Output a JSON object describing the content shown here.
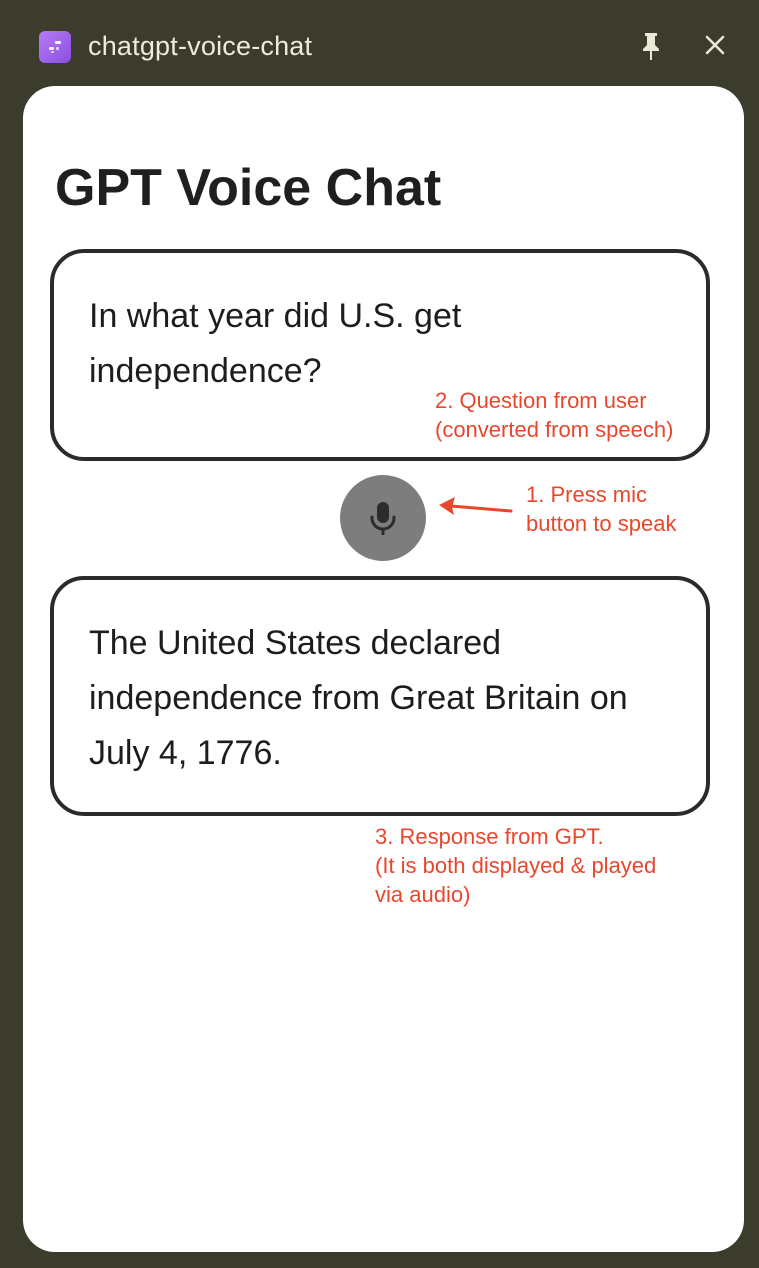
{
  "window": {
    "title": "chatgpt-voice-chat"
  },
  "app": {
    "heading": "GPT Voice Chat",
    "question_text": "In what year did U.S. get independence?",
    "response_text": "The United States declared independence from Great Britain on July 4, 1776."
  },
  "annotations": {
    "question": "2. Question from user\n(converted from speech)",
    "mic": "1. Press mic\nbutton to speak",
    "response": "3. Response from GPT.\n(It is both displayed & played\nvia audio)"
  },
  "icons": {
    "app": "app-icon",
    "pin": "pin-icon",
    "close": "close-icon",
    "mic": "microphone-icon",
    "arrow": "arrow-left-icon"
  },
  "colors": {
    "window_bg": "#3b3c2c",
    "panel_bg": "#ffffff",
    "annotation": "#e8472c",
    "mic_button": "#7d7d7d",
    "bubble_border": "#2b2b2b"
  }
}
